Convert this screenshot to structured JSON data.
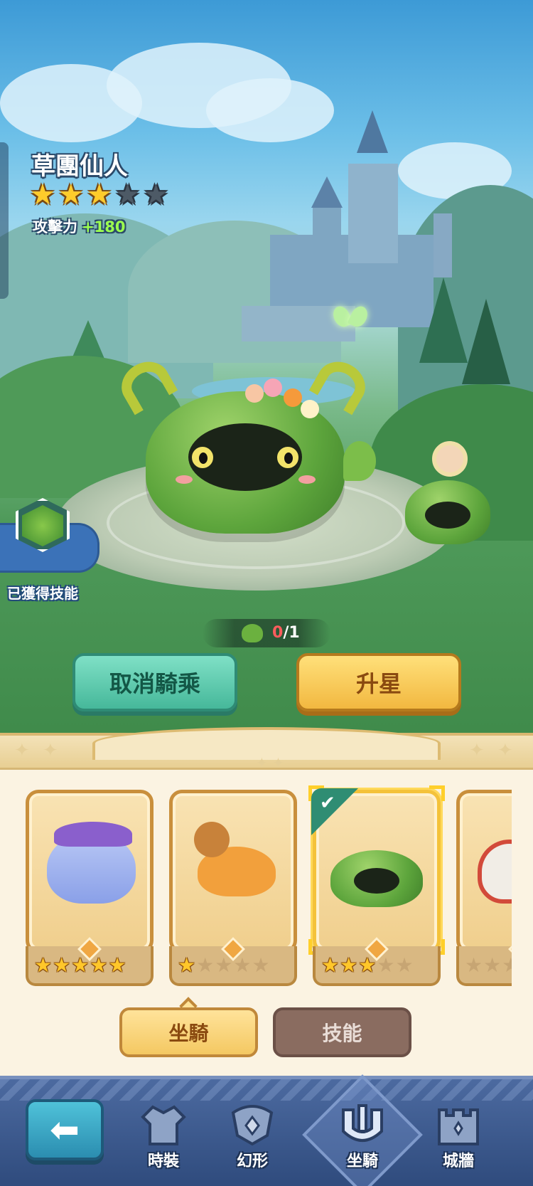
{
  "mount": {
    "name": "草團仙人",
    "star_level": 3,
    "max_stars": 5,
    "attack_label": "攻擊力",
    "attack_value": "+180"
  },
  "skill_badge": {
    "label": "已獲得技能"
  },
  "material": {
    "have": "0",
    "separator": "/",
    "need": "1"
  },
  "actions": {
    "cancel_ride": "取消騎乘",
    "upgrade_star": "升星"
  },
  "mount_list": [
    {
      "name": "purple-elephant-mount",
      "stars": 5,
      "selected": false
    },
    {
      "name": "aviator-duck-mount",
      "stars": 1,
      "selected": false
    },
    {
      "name": "grass-cactus-mount",
      "stars": 3,
      "selected": true
    },
    {
      "name": "lion-dance-mount",
      "stars": 0,
      "selected": false
    }
  ],
  "tabs": {
    "mount": "坐騎",
    "skill": "技能",
    "active": "mount"
  },
  "nav": {
    "back_icon": "back-arrow-icon",
    "items": [
      {
        "label": "時裝",
        "icon": "costume-icon"
      },
      {
        "label": "幻形",
        "icon": "transform-icon"
      },
      {
        "label": "坐騎",
        "icon": "mount-icon",
        "active": true
      },
      {
        "label": "城牆",
        "icon": "castle-wall-icon"
      }
    ]
  },
  "colors": {
    "star_on": "#ffcc2a",
    "star_off": "#4d5a66",
    "attack_value": "#9cff4f",
    "cancel_button": "#46b89a",
    "upgrade_button": "#f2b840",
    "nav_bg": "#3a5a8e"
  }
}
